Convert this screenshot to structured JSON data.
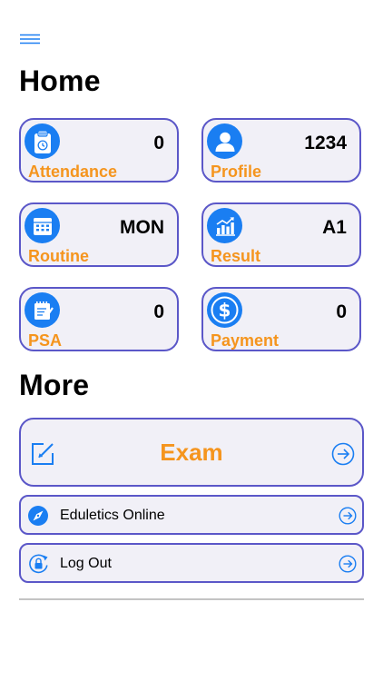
{
  "header": {
    "menu_icon": "hamburger-menu-icon"
  },
  "home": {
    "title": "Home",
    "tiles": [
      {
        "label": "Attendance",
        "value": "0",
        "icon": "clipboard-clock-icon"
      },
      {
        "label": "Profile",
        "value": "1234",
        "icon": "user-icon"
      },
      {
        "label": "Routine",
        "value": "MON",
        "icon": "calendar-icon"
      },
      {
        "label": "Result",
        "value": "A1",
        "icon": "bar-chart-icon"
      },
      {
        "label": "PSA",
        "value": "0",
        "icon": "notepad-check-icon"
      },
      {
        "label": "Payment",
        "value": "0",
        "icon": "dollar-icon"
      }
    ]
  },
  "more": {
    "title": "More",
    "exam": {
      "label": "Exam",
      "icon": "edit-icon"
    },
    "items": [
      {
        "label": "Eduletics Online",
        "icon": "compass-icon"
      },
      {
        "label": "Log Out",
        "icon": "logout-lock-icon"
      }
    ]
  },
  "colors": {
    "accent_blue": "#1a7ef2",
    "label_orange": "#f5951e",
    "card_border": "#5b57c8",
    "card_background": "#f1f0f7",
    "divider": "#c4c4c4"
  }
}
